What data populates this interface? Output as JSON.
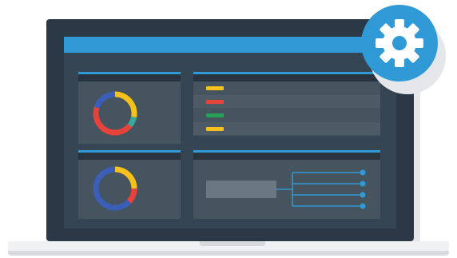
{
  "colors": {
    "bezel": "#2b3947",
    "display": "#364553",
    "accent": "#2f9ad6",
    "panel": "#46545f",
    "yellow": "#f5c11a",
    "red": "#e8423b",
    "green": "#23a355",
    "blue": "#3b5fb8",
    "teal": "#3aa89a"
  },
  "donut_chart_1": {
    "segments": [
      {
        "color_key": "yellow",
        "fraction": 0.28
      },
      {
        "color_key": "teal",
        "fraction": 0.08
      },
      {
        "color_key": "red",
        "fraction": 0.44
      },
      {
        "color_key": "blue",
        "fraction": 0.2
      }
    ]
  },
  "donut_chart_2": {
    "segments": [
      {
        "color_key": "yellow",
        "fraction": 0.25
      },
      {
        "color_key": "red",
        "fraction": 0.12
      },
      {
        "color_key": "blue",
        "fraction": 0.63
      }
    ]
  },
  "legend": {
    "items": [
      {
        "color_key": "yellow"
      },
      {
        "color_key": "red"
      },
      {
        "color_key": "green"
      },
      {
        "color_key": "yellow"
      }
    ]
  },
  "flow": {
    "branch_count": 4
  },
  "settings_button": {
    "icon": "gear-icon"
  }
}
